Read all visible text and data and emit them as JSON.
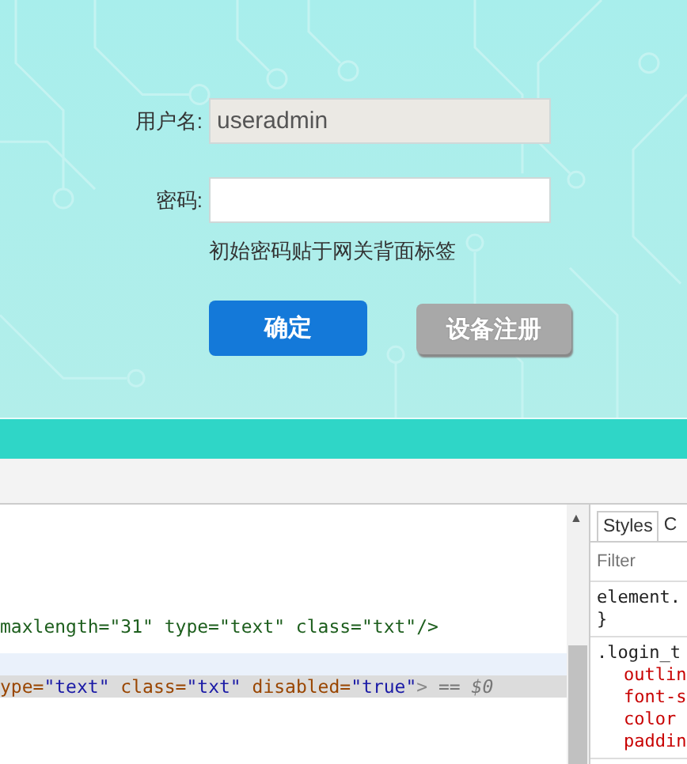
{
  "login": {
    "fields": [
      {
        "label": "用户名:",
        "value": "useradmin",
        "disabled": true
      },
      {
        "label": "密码:",
        "disabled": false
      }
    ],
    "hint": "初始密码贴于网关背面标签",
    "buttons": [
      {
        "label": "确定",
        "kind": "primary"
      },
      {
        "label": "设备注册",
        "kind": "secondary"
      }
    ]
  },
  "devtools": {
    "elements": {
      "lines": [
        {
          "selected": false,
          "hovered": false,
          "tokens": [
            {
              "kind": "edited",
              "text": "maxlength=\"31\" type=\"text\" class=\"txt\"/>"
            }
          ]
        },
        {
          "selected": false,
          "hovered": true
        },
        {
          "selected": true,
          "hovered": false,
          "tokens": [
            {
              "kind": "name",
              "text": "ype="
            },
            {
              "kind": "value",
              "text": "\"text\""
            },
            {
              "kind": "name",
              "text": " class="
            },
            {
              "kind": "value",
              "text": "\"txt\""
            },
            {
              "kind": "name",
              "text": " disabled="
            },
            {
              "kind": "value",
              "text": "\"true\""
            },
            {
              "kind": "punct",
              "text": ">"
            },
            {
              "kind": "marker",
              "text": " == $0"
            }
          ]
        }
      ],
      "scroll_up": "▲"
    },
    "styles": {
      "tabs": [
        {
          "label": "Styles",
          "selected": true
        },
        {
          "label": "C",
          "selected": false
        }
      ],
      "filter": {
        "placeholder": "Filter"
      },
      "rules": [
        {
          "lines": [
            {
              "kind": "selector",
              "text": "element."
            },
            {
              "kind": "brace",
              "text": "}"
            }
          ]
        },
        {
          "lines": [
            {
              "kind": "selector",
              "text": ".login_t"
            },
            {
              "kind": "property",
              "text": "outlin"
            },
            {
              "kind": "property",
              "text": "font-s"
            },
            {
              "kind": "property",
              "text": "color"
            },
            {
              "kind": "property",
              "text": "paddin"
            }
          ]
        }
      ]
    }
  }
}
